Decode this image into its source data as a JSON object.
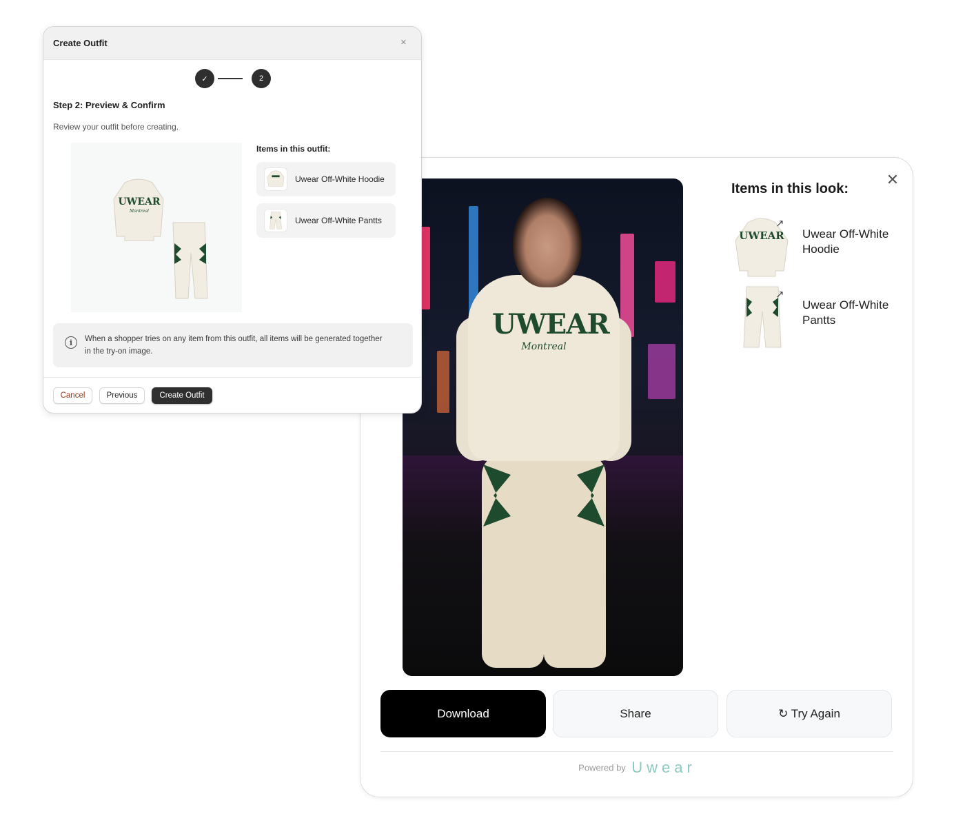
{
  "result": {
    "title": "Items in this look:",
    "close_icon": "close-icon",
    "items": [
      {
        "name": "Uwear Off-White Hoodie",
        "icon": "external-link-icon",
        "ext_glyph": "↗"
      },
      {
        "name": "Uwear Off-White Pantts",
        "icon": "external-link-icon",
        "ext_glyph": "↗"
      }
    ],
    "photo": {
      "hoodie_text": "UWEAR",
      "hoodie_script": "Montreal"
    },
    "buttons": {
      "download": "Download",
      "share": "Share",
      "try_again": "↻ Try Again"
    },
    "powered_label": "Powered by",
    "powered_brand": "Uwear"
  },
  "modal": {
    "title": "Create Outfit",
    "close_glyph": "×",
    "steps": [
      {
        "label": "✓",
        "state": "complete"
      },
      {
        "label": "2",
        "state": "current"
      }
    ],
    "step_heading": "Step 2: Preview & Confirm",
    "step_desc": "Review your outfit before creating.",
    "preview": {
      "hoodie_text": "UWEAR",
      "hoodie_script": "Montreal"
    },
    "items_label": "Items in this outfit:",
    "items": [
      {
        "name": "Uwear Off-White Hoodie"
      },
      {
        "name": "Uwear Off-White Pantts"
      }
    ],
    "info_icon": "info-icon",
    "info_glyph": "i",
    "info_text": "When a shopper tries on any item from this outfit, all items will be generated together in the try-on image.",
    "buttons": {
      "cancel": "Cancel",
      "previous": "Previous",
      "create": "Create Outfit"
    }
  },
  "colors": {
    "brand_teal": "#8cc9c0",
    "garment_green": "#1e4a2e",
    "cream": "#efe8d8",
    "primary_dark": "#2f2f2f",
    "cancel_text": "#9a3412"
  }
}
